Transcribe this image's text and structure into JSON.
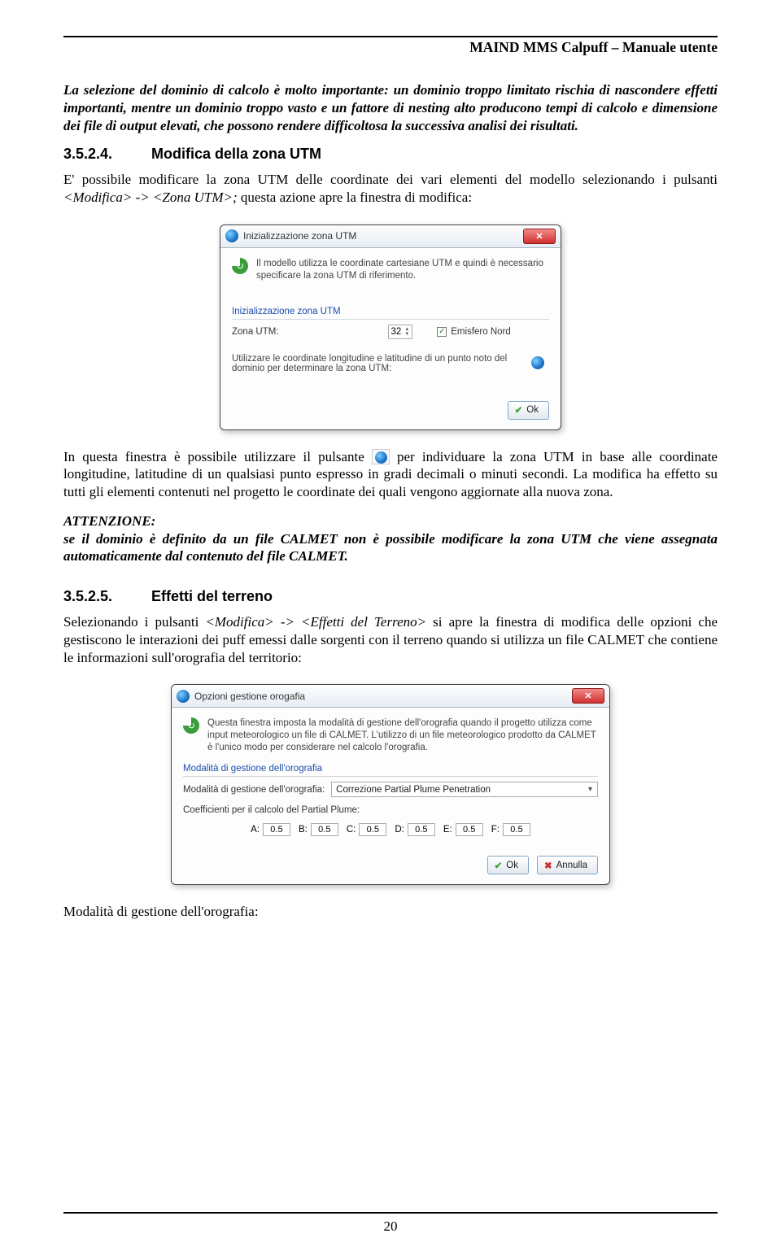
{
  "header": {
    "title": "MAIND MMS Calpuff – Manuale utente"
  },
  "p1": "La selezione del dominio di calcolo è molto importante: un dominio troppo limitato rischia di nascondere effetti importanti, mentre un dominio troppo vasto e un fattore di nesting alto producono tempi di calcolo e dimensione dei file di output elevati, che possono rendere difficoltosa la successiva analisi dei risultati.",
  "h1": {
    "num": "3.5.2.4.",
    "txt": "Modifica della zona UTM"
  },
  "p2a": "E' possibile modificare la zona UTM delle coordinate dei vari elementi del modello selezionando i pulsanti ",
  "p2b": "<Modifica> -> <Zona UTM>;",
  "p2c": " questa azione apre la finestra di modifica:",
  "dlg1": {
    "title": "Inizializzazione zona UTM",
    "blur": "",
    "info": "Il modello utilizza le coordinate cartesiane UTM e quindi è necessario specificare la zona UTM di riferimento.",
    "group": "Inizializzazione zona UTM",
    "label_zone": "Zona UTM:",
    "zone_value": "32",
    "chk_label": "Emisfero Nord",
    "subtext": "Utilizzare le coordinate longitudine e latitudine di un punto noto del dominio per determinare la zona UTM:",
    "ok": "Ok"
  },
  "p3a": "In questa finestra è possibile utilizzare il pulsante ",
  "p3b": " per individuare la zona UTM in base alle coordinate longitudine, latitudine di un qualsiasi punto espresso in gradi decimali o minuti secondi. La modifica ha effetto su tutti gli elementi contenuti nel progetto le coordinate dei quali vengono aggiornate alla nuova zona.",
  "att": {
    "title": "ATTENZIONE:",
    "body": "se il dominio è definito da un file CALMET non è possibile modificare la zona UTM che viene assegnata automaticamente dal contenuto del file CALMET."
  },
  "h2": {
    "num": "3.5.2.5.",
    "txt": "Effetti del terreno"
  },
  "p4a": "Selezionando i pulsanti ",
  "p4b": "<Modifica> -> <Effetti del Terreno>",
  "p4c": "  si apre la finestra di modifica delle opzioni che gestiscono le interazioni dei puff emessi dalle sorgenti con il terreno quando si utilizza un file CALMET che contiene le informazioni sull'orografia del territorio:",
  "dlg2": {
    "title": "Opzioni gestione orogafia",
    "info": "Questa finestra imposta la modalità di gestione dell'orografia quando il progetto utilizza come input meteorologico un file di CALMET. L'utilizzo di un file meteorologico prodotto da CALMET è l'unico modo per considerare nel calcolo l'orografia.",
    "group": "Modalità di gestione dell'orografia",
    "label_mode": "Modalità di gestione dell'orografia:",
    "mode_value": "Correzione Partial Plume Penetration",
    "coeff_label": "Coefficienti per il calcolo del Partial Plume:",
    "coeffs": {
      "A": "0.5",
      "B": "0.5",
      "C": "0.5",
      "D": "0.5",
      "E": "0.5",
      "F": "0.5"
    },
    "ok": "Ok",
    "cancel": "Annulla"
  },
  "p5": "Modalità di gestione dell'orografia:",
  "footer": {
    "page": "20"
  }
}
